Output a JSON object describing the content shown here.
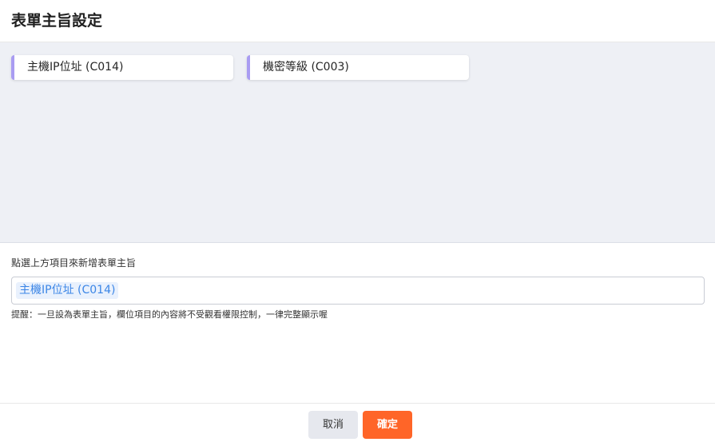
{
  "dialog": {
    "title": "表單主旨設定"
  },
  "available_fields": [
    {
      "label": "主機IP位址 (C014)"
    },
    {
      "label": "機密等級 (C003)"
    }
  ],
  "subject": {
    "label": "點選上方項目來新增表單主旨",
    "selected_tags": [
      "主機IP位址 (C014)"
    ],
    "hint": "提醒：一旦設為表單主旨，欄位項目的內容將不受觀看權限控制，一律完整顯示喔"
  },
  "actions": {
    "cancel_label": "取消",
    "confirm_label": "確定"
  },
  "colors": {
    "chip_accent": "#a99cf2",
    "pool_background": "#eef0f5",
    "tag_text": "#3c86e6",
    "tag_background": "#e9f1fd",
    "confirm_button": "#ff6528",
    "cancel_button": "#e6e8ee"
  }
}
